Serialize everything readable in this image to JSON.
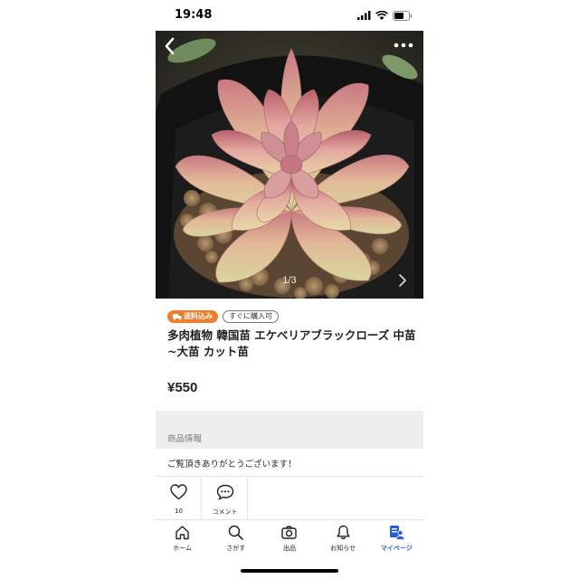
{
  "status_bar": {
    "time": "19:48"
  },
  "hero": {
    "counter": "1/3",
    "icons": {
      "back": "chevron-left-icon",
      "more": "more-dots-icon",
      "next": "chevron-right-icon"
    }
  },
  "badges": {
    "shipping": "送料込み",
    "instant": "すぐに購入可"
  },
  "item": {
    "title": "多肉植物 韓国苗 エケベリアブラックローズ 中苗~大苗 カット苗",
    "price": "¥550"
  },
  "info": {
    "header": "商品情報",
    "description": "ご覧頂きありがとうございます！"
  },
  "actions": {
    "like_count": "10",
    "comment_label": "コメント"
  },
  "tabbar": [
    {
      "label": "ホーム",
      "icon": "home-icon"
    },
    {
      "label": "さがす",
      "icon": "search-icon"
    },
    {
      "label": "出品",
      "icon": "camera-icon"
    },
    {
      "label": "お知らせ",
      "icon": "bell-icon"
    },
    {
      "label": "マイページ",
      "icon": "mypage-icon",
      "active": true
    }
  ],
  "colors": {
    "accent": "#2160d6",
    "shipping_badge": "#ee7d2d"
  }
}
